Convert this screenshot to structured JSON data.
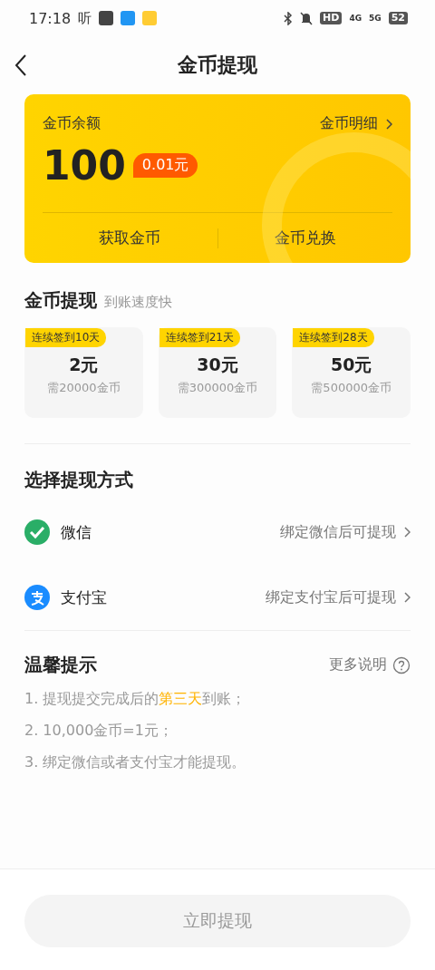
{
  "status_bar": {
    "time": "17:18",
    "app_glyph": "听",
    "hd": "HD",
    "net_1": "4G",
    "net_2": "5G",
    "battery": "52"
  },
  "header": {
    "title": "金币提现"
  },
  "balance_card": {
    "label": "金币余额",
    "detail_link": "金币明细",
    "amount": "100",
    "cash_value": "0.01元",
    "actions": [
      "获取金币",
      "金币兑换"
    ]
  },
  "withdraw": {
    "title": "金币提现",
    "subtitle": "到账速度快",
    "options": [
      {
        "tag": "连续签到10天",
        "amount": "2元",
        "cost": "需20000金币",
        "selected": false
      },
      {
        "tag": "连续签到21天",
        "amount": "30元",
        "cost": "需300000金币",
        "selected": false
      },
      {
        "tag": "连续签到28天",
        "amount": "50元",
        "cost": "需500000金币",
        "selected": false
      }
    ]
  },
  "methods": {
    "title": "选择提现方式",
    "items": [
      {
        "kind": "wechat",
        "name": "微信",
        "action": "绑定微信后可提现"
      },
      {
        "kind": "alipay",
        "name": "支付宝",
        "action": "绑定支付宝后可提现"
      }
    ]
  },
  "tips": {
    "title": "温馨提示",
    "more": "更多说明",
    "items": [
      [
        {
          "text": "1. 提现提交完成后的",
          "highlight": false
        },
        {
          "text": "第三天",
          "highlight": true
        },
        {
          "text": "到账；",
          "highlight": false
        }
      ],
      [
        {
          "text": "2. 10,000金币=1元；",
          "highlight": false
        }
      ],
      [
        {
          "text": "3. 绑定微信或者支付宝才能提现。",
          "highlight": false
        }
      ]
    ]
  },
  "submit": {
    "label": "立即提现",
    "disabled": true
  }
}
